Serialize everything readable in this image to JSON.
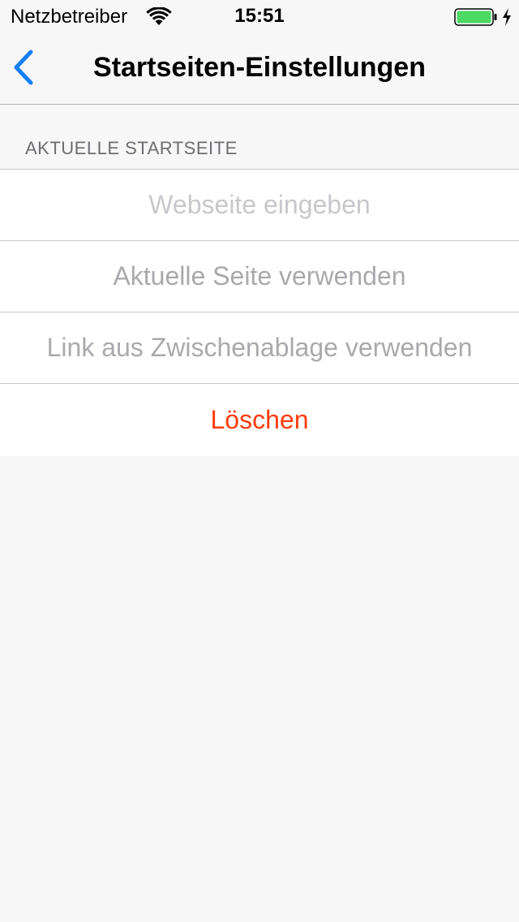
{
  "status_bar": {
    "carrier": "Netzbetreiber",
    "time": "15:51",
    "wifi_icon": "wifi-icon",
    "battery_icon": "battery-icon",
    "charging_icon": "charging-bolt-icon",
    "battery_level": 1.0
  },
  "nav": {
    "back_icon": "chevron-left-icon",
    "title": "Startseiten-Einstellungen"
  },
  "section": {
    "header": "AKTUELLE STARTSEITE"
  },
  "rows": [
    {
      "label": "Webseite eingeben",
      "kind": "input-placeholder"
    },
    {
      "label": "Aktuelle Seite verwenden",
      "kind": "disabled"
    },
    {
      "label": "Link aus Zwischenablage verwenden",
      "kind": "disabled"
    },
    {
      "label": "Löschen",
      "kind": "destructive"
    }
  ],
  "colors": {
    "accent": "#157efb",
    "destructive": "#ff3b0a",
    "placeholder": "#c7c7cd",
    "disabled_text": "#a9a9ae",
    "section_header": "#6d6d72",
    "background": "#f7f7f7",
    "battery_fill": "#4cd964"
  }
}
